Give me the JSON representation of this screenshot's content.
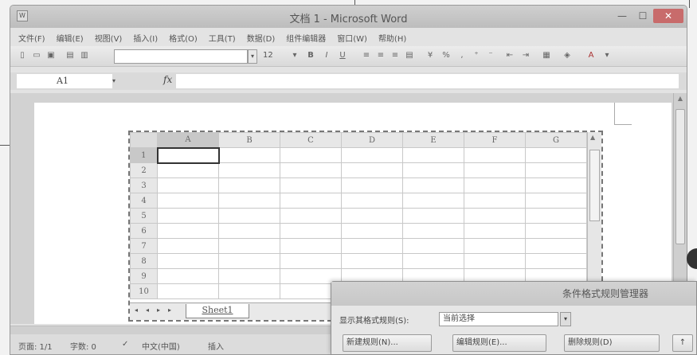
{
  "window": {
    "title": "文档 1 - Microsoft Word",
    "minimize": "—",
    "maximize": "☐",
    "close": "✕"
  },
  "menu": [
    "文件(F)",
    "编辑(E)",
    "视图(V)",
    "插入(I)",
    "格式(O)",
    "工具(T)",
    "数据(D)",
    "组件编辑器",
    "窗口(W)",
    "帮助(H)"
  ],
  "toolbar": {
    "font_size": "12",
    "bold": "B",
    "italic": "I",
    "underline": "U",
    "percent": "%"
  },
  "formula_bar": {
    "name_box": "A1",
    "fx": "fx",
    "formula": ""
  },
  "sheet": {
    "columns": [
      "A",
      "B",
      "C",
      "D",
      "E",
      "F",
      "G"
    ],
    "rows": [
      "1",
      "2",
      "3",
      "4",
      "5",
      "6",
      "7",
      "8",
      "9",
      "10"
    ],
    "active_cell": "A1",
    "tab_name": "Sheet1",
    "tab_nav": [
      "◂",
      "◂",
      "▸",
      "▸"
    ]
  },
  "status": {
    "page": "页面: 1/1",
    "words": "字数: 0",
    "language": "中文(中国)",
    "mode": "插入"
  },
  "dialog": {
    "title": "条件格式规则管理器",
    "show_rules_label": "显示其格式规则(S):",
    "show_rules_value": "当前选择",
    "new_rule": "新建规则(N)...",
    "edit_rule": "编辑规则(E)...",
    "delete_rule": "删除规则(D)",
    "up": "↑"
  }
}
